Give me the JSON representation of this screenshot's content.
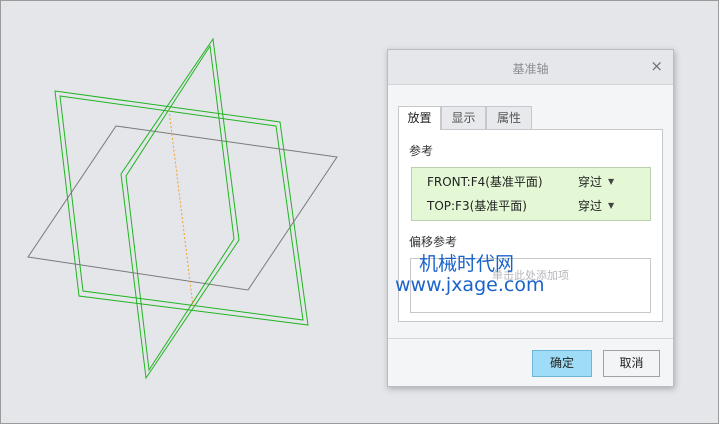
{
  "dialog": {
    "title": "基准轴",
    "close_glyph": "×",
    "tabs": [
      {
        "label": "放置"
      },
      {
        "label": "显示"
      },
      {
        "label": "属性"
      }
    ],
    "references_label": "参考",
    "references": [
      {
        "name": "FRONT:F4(基准平面)",
        "mode": "穿过"
      },
      {
        "name": "TOP:F3(基准平面)",
        "mode": "穿过"
      }
    ],
    "dropdown_glyph": "▼",
    "offset_label": "偏移参考",
    "offset_hint": "单击此处添加项",
    "ok_label": "确定",
    "cancel_label": "取消"
  },
  "watermark": {
    "line1": "机械时代网",
    "line2": "www.jxage.com"
  },
  "colors": {
    "background": "#e4e6ea",
    "datum_plane_green": "#22b422",
    "datum_plane_gray": "#7a7a7a",
    "axis_orange": "#f0a030",
    "reference_highlight": "#e4f8d6",
    "primary_button": "#9fdcf7",
    "watermark": "#1b63c9"
  },
  "icons": {
    "close": "close-icon",
    "dropdown": "dropdown-arrow-icon"
  }
}
